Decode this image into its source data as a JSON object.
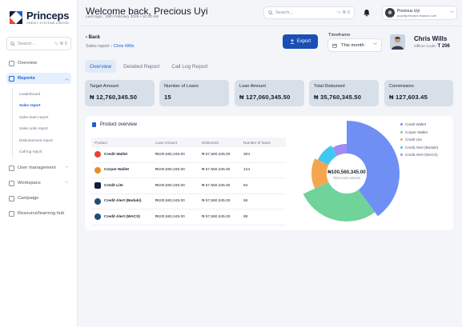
{
  "brand": {
    "name": "Princeps",
    "tagline": "CREDIT SYSTEMS LIMITED"
  },
  "sidebar": {
    "search_placeholder": "Search...",
    "search_shortcut": "⌥ ⌘ S",
    "items": [
      {
        "label": "Overview"
      },
      {
        "label": "Reports"
      },
      {
        "label": "User management"
      },
      {
        "label": "Workspace"
      },
      {
        "label": "Campaign"
      },
      {
        "label": "Resource/learning hub"
      }
    ],
    "report_subitems": [
      "Leaderboard",
      "Sales report",
      "Sales team report",
      "Sales units report",
      "Disbursement report",
      "Call log report"
    ]
  },
  "header": {
    "welcome": "Welcome back, Precious Uyi",
    "last_login": "Last login :  29th February 2025",
    "time": "10:30 AM",
    "search_placeholder": "Search...",
    "search_shortcut": "⌥ ⌘ S",
    "user_name": "Precious Uyi",
    "user_email": "puyi@princeps finance.com"
  },
  "page": {
    "back_label": "Back",
    "breadcrumb_parent": "Sales report",
    "breadcrumb_current": "Chris Wills",
    "export_label": "Export",
    "timeframe_label": "Timeframe",
    "timeframe_value": "This month",
    "officer_name": "Chris Wills",
    "officer_code_label": "Officer Code:",
    "officer_code": "T 206"
  },
  "tabs": [
    "Overview",
    "Detailed Report",
    "Call Log Report"
  ],
  "stats": [
    {
      "label": "Target Amount",
      "value": "₦ 12,760,345.50"
    },
    {
      "label": "Number of Loans",
      "value": "15"
    },
    {
      "label": "Loan Amount",
      "value": "₦ 127,060,345.50"
    },
    {
      "label": "Total Disbursed",
      "value": "₦ 35,760,345.50"
    },
    {
      "label": "Commission",
      "value": "₦ 127,603.45"
    }
  ],
  "product_overview": {
    "title": "Product overview",
    "columns": [
      "Product",
      "Loan Amount",
      "Disbursed",
      "Number of loans"
    ],
    "rows": [
      {
        "product": "Credit Wallet",
        "loan": "₦100,560,345.00",
        "disbursed": "₦ 57,560,345.00",
        "count": "304"
      },
      {
        "product": "Corper Wallet",
        "loan": "₦100,560,345.00",
        "disbursed": "₦ 57,560,345.00",
        "count": "124"
      },
      {
        "product": "Credit Lite",
        "loan": "₦100,560,345.00",
        "disbursed": "₦ 57,560,345.00",
        "count": "64"
      },
      {
        "product": "Credit Alert (Beduki)",
        "loan": "₦100,560,345.00",
        "disbursed": "₦ 57,560,345.00",
        "count": "56"
      },
      {
        "product": "Credit Alert (WACS)",
        "loan": "₦100,560,345.00",
        "disbursed": "₦ 57,560,345.00",
        "count": "89"
      }
    ]
  },
  "chart_data": {
    "type": "pie",
    "center_value": "₦100,560,345.00",
    "center_label": "Total Loan amount",
    "labels": [
      "Credit Wallet",
      "Corper Wallet",
      "Credit Lite",
      "Credit Alert (Beduki)",
      "Credit Alert (WACS)"
    ],
    "values": [
      40,
      28,
      14,
      10,
      8
    ],
    "colors": [
      "#6f8ff5",
      "#6fd39a",
      "#f5a54f",
      "#40c8f2",
      "#a18cf0"
    ],
    "legend_position": "right"
  }
}
